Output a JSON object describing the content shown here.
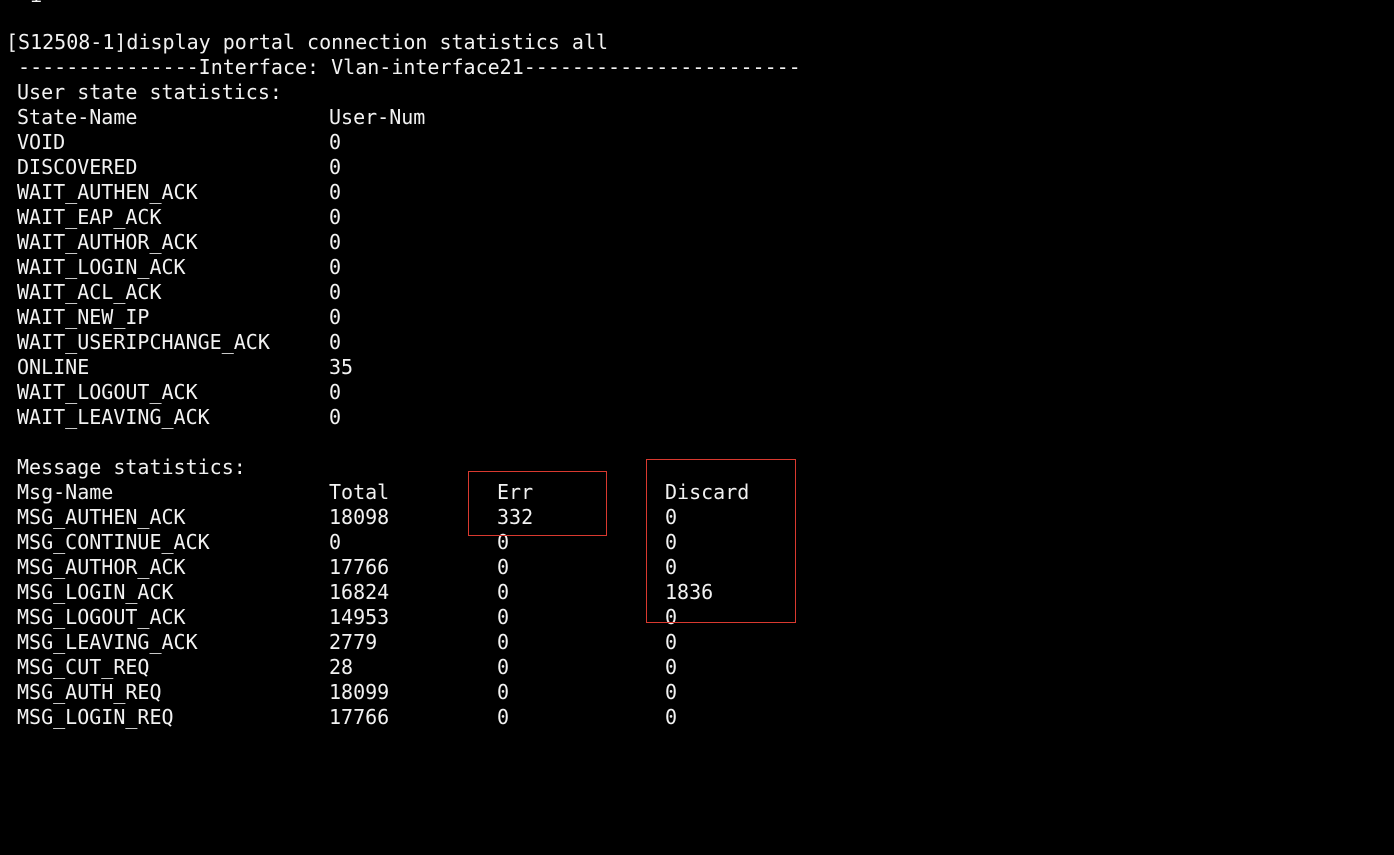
{
  "terminal": {
    "partial_top_line": "  ı",
    "command_line": "[S12508-1]display portal connection statistics all",
    "interface_separator": " ---------------Interface: Vlan-interface21-----------------------",
    "user_state": {
      "title": "User state statistics:",
      "headers": [
        "State-Name",
        "User-Num"
      ],
      "rows": [
        [
          "VOID",
          "0"
        ],
        [
          "DISCOVERED",
          "0"
        ],
        [
          "WAIT_AUTHEN_ACK",
          "0"
        ],
        [
          "WAIT_EAP_ACK",
          "0"
        ],
        [
          "WAIT_AUTHOR_ACK",
          "0"
        ],
        [
          "WAIT_LOGIN_ACK",
          "0"
        ],
        [
          "WAIT_ACL_ACK",
          "0"
        ],
        [
          "WAIT_NEW_IP",
          "0"
        ],
        [
          "WAIT_USERIPCHANGE_ACK",
          "0"
        ],
        [
          "ONLINE",
          "35"
        ],
        [
          "WAIT_LOGOUT_ACK",
          "0"
        ],
        [
          "WAIT_LEAVING_ACK",
          "0"
        ]
      ]
    },
    "message_stats": {
      "title": "Message statistics:",
      "headers": [
        "Msg-Name",
        "Total",
        "Err",
        "Discard"
      ],
      "rows": [
        [
          "MSG_AUTHEN_ACK",
          "18098",
          "332",
          "0"
        ],
        [
          "MSG_CONTINUE_ACK",
          "0",
          "0",
          "0"
        ],
        [
          "MSG_AUTHOR_ACK",
          "17766",
          "0",
          "0"
        ],
        [
          "MSG_LOGIN_ACK",
          "16824",
          "0",
          "1836"
        ],
        [
          "MSG_LOGOUT_ACK",
          "14953",
          "0",
          "0"
        ],
        [
          "MSG_LEAVING_ACK",
          "2779",
          "0",
          "0"
        ],
        [
          "MSG_CUT_REQ",
          "28",
          "0",
          "0"
        ],
        [
          "MSG_AUTH_REQ",
          "18099",
          "0",
          "0"
        ],
        [
          "MSG_LOGIN_REQ",
          "17766",
          "0",
          "0"
        ]
      ]
    }
  },
  "colors": {
    "background": "#000000",
    "text": "#f2f2f2",
    "highlight_box": "#d9392f"
  }
}
